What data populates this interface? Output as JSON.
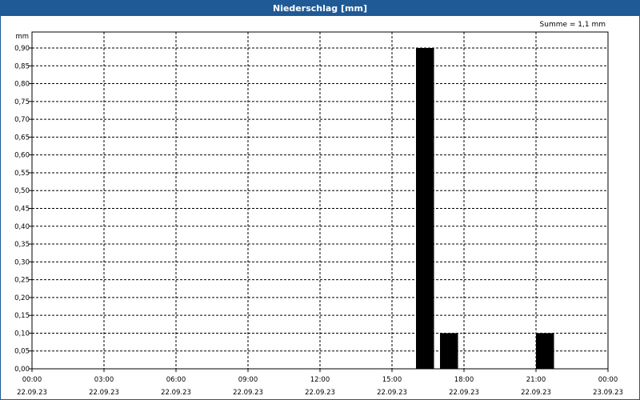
{
  "chart_data": {
    "type": "bar",
    "title": "Niederschlag [mm]",
    "ylabel": "mm",
    "annotation": "Summe = 1,1 mm",
    "ylim": [
      0,
      0.9
    ],
    "ytick_step": 0.05,
    "ytick_labels": [
      "0,00",
      "0,05",
      "0,10",
      "0,15",
      "0,20",
      "0,25",
      "0,30",
      "0,35",
      "0,40",
      "0,45",
      "0,50",
      "0,55",
      "0,60",
      "0,65",
      "0,70",
      "0,75",
      "0,80",
      "0,85",
      "0,90"
    ],
    "xlim_hours": [
      0,
      24
    ],
    "xticks": [
      {
        "time": "00:00",
        "date": "22.09.23"
      },
      {
        "time": "03:00",
        "date": "22.09.23"
      },
      {
        "time": "06:00",
        "date": "22.09.23"
      },
      {
        "time": "09:00",
        "date": "22.09.23"
      },
      {
        "time": "12:00",
        "date": "22.09.23"
      },
      {
        "time": "15:00",
        "date": "22.09.23"
      },
      {
        "time": "18:00",
        "date": "22.09.23"
      },
      {
        "time": "21:00",
        "date": "22.09.23"
      },
      {
        "time": "00:00",
        "date": "23.09.23"
      }
    ],
    "grid": true,
    "bars": [
      {
        "x": "22.09.23 16:00–16:45",
        "value": 0.9
      },
      {
        "x": "22.09.23 17:00–17:45",
        "value": 0.1
      },
      {
        "x": "22.09.23 21:00–21:45",
        "value": 0.1
      }
    ]
  }
}
